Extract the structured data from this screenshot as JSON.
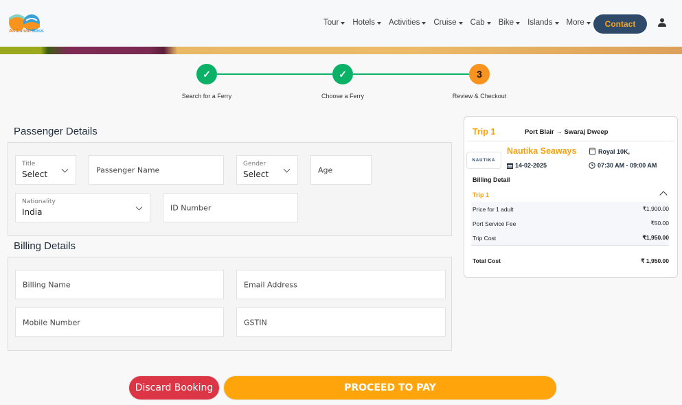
{
  "brand": {
    "name_part1": "Andaman",
    "name_part2": "Bliss"
  },
  "nav": {
    "items": [
      {
        "label": "Tour"
      },
      {
        "label": "Hotels"
      },
      {
        "label": "Activities"
      },
      {
        "label": "Cruise"
      },
      {
        "label": "Cab"
      },
      {
        "label": "Bike"
      },
      {
        "label": "Islands"
      },
      {
        "label": "More"
      }
    ],
    "contact_label": "Contact",
    "user_icon": "user-icon"
  },
  "stepper": {
    "steps": [
      {
        "label": "Search for a Ferry",
        "status": "done",
        "marker": "✓"
      },
      {
        "label": "Choose a Ferry",
        "status": "done",
        "marker": "✓"
      },
      {
        "label": "Review & Checkout",
        "status": "active",
        "marker": "3"
      }
    ],
    "done_color": "#0bb167",
    "active_color": "#f7931e"
  },
  "passenger": {
    "title": "Passenger Details",
    "title_field": {
      "label": "Title",
      "value": "Select"
    },
    "name_placeholder": "Passenger Name",
    "gender_field": {
      "label": "Gender",
      "value": "Select"
    },
    "age_placeholder": "Age",
    "nationality_field": {
      "label": "Nationality",
      "value": "India"
    },
    "id_placeholder": "ID Number"
  },
  "billing": {
    "title": "Billing Details",
    "name_placeholder": "Billing Name",
    "email_placeholder": "Email Address",
    "mobile_placeholder": "Mobile Number",
    "gstin_placeholder": "GSTIN"
  },
  "summary": {
    "trip_label": "Trip 1",
    "route": "Port Blair → Swaraj Dweep",
    "operator_logo_text": "NAUTIKA",
    "operator_name": "Nautika Seaways",
    "vessel": "Royal 10K,",
    "date": "14-02-2025",
    "time": "07:30 AM - 09:00 AM",
    "billing_detail_label": "Billing Detail",
    "billing_trip_label": "Trip 1",
    "rows": [
      {
        "label": "Price for 1 adult",
        "value": "₹1,900.00"
      },
      {
        "label": "Port Service Fee",
        "value": "₹50.00"
      },
      {
        "label": "Trip Cost",
        "value": "₹1,950.00"
      }
    ],
    "total_label": "Total Cost",
    "total_value": "₹ 1,950.00"
  },
  "actions": {
    "discard_label": "Discard Booking",
    "proceed_label": "PROCEED TO PAY"
  },
  "colors": {
    "accent": "#f5a20f",
    "primary_dark": "#2f4a68",
    "danger": "#dc3545",
    "proceed": "#ffa40a"
  }
}
